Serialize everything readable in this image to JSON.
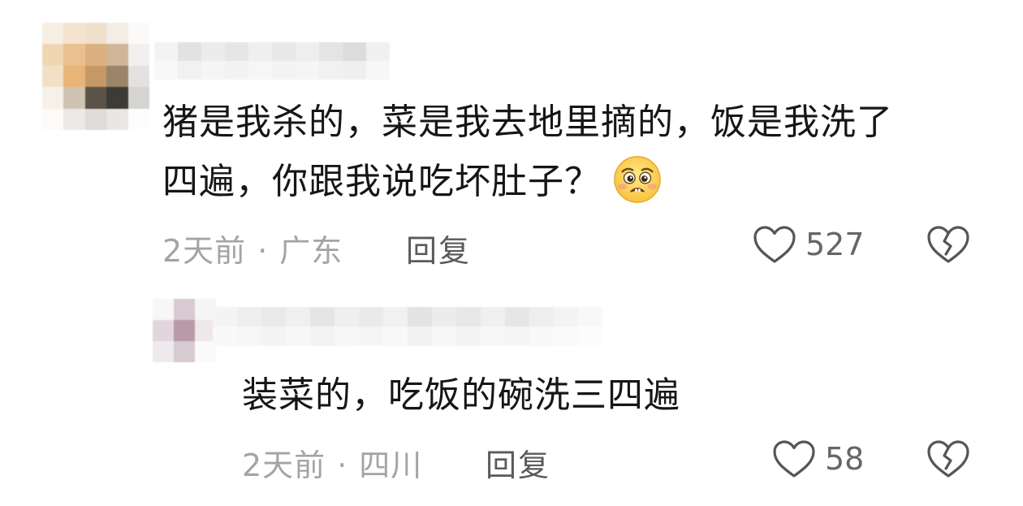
{
  "comment": {
    "text_line1": "猪是我杀的，菜是我去地里摘的，饭是我洗了",
    "text_line2": "四遍，你跟我说吃坏肚子？",
    "emoji": "worried-face-icon",
    "time": "2天前",
    "separator": "·",
    "location": "广东",
    "reply_label": "回复",
    "like_count": "527"
  },
  "reply": {
    "text": "装菜的，吃饭的碗洗三四遍",
    "time": "2天前",
    "separator": "·",
    "location": "四川",
    "reply_label": "回复",
    "like_count": "58"
  },
  "colors": {
    "meta_text": "#a4a4a4",
    "reply_button": "#5a5a5a",
    "icon_stroke": "#555555"
  }
}
